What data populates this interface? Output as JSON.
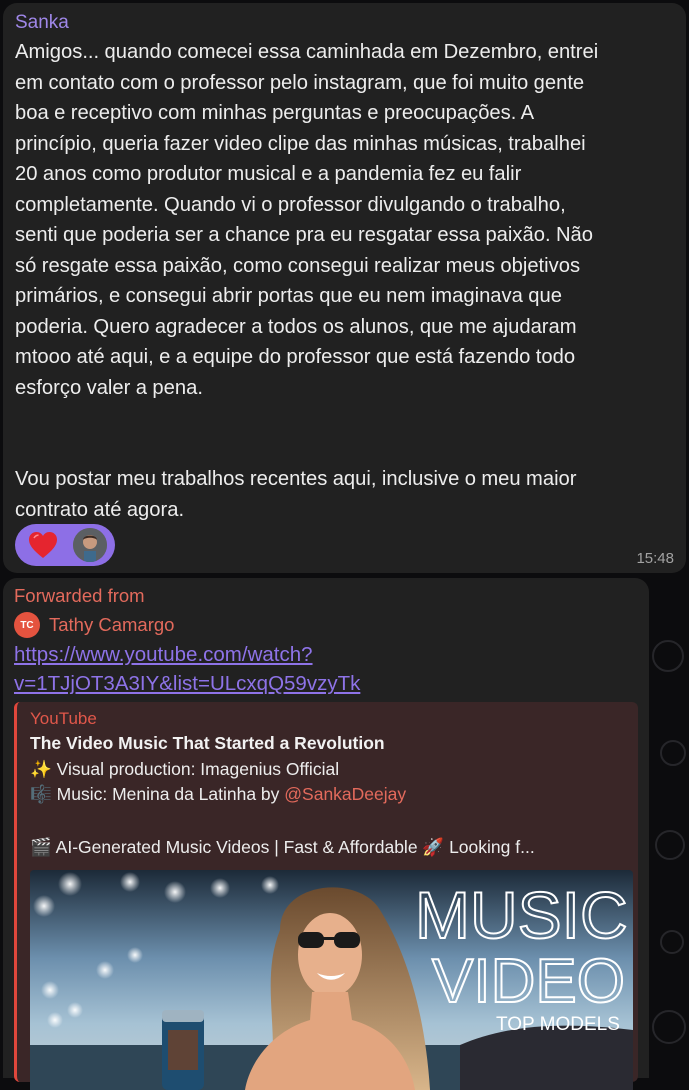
{
  "message1": {
    "sender": "Sanka",
    "lines": [
      "Amigos... quando comecei essa caminhada em Dezembro, entrei",
      "em contato com o professor pelo instagram, que foi muito gente",
      "boa e receptivo com minhas perguntas e preocupações. A",
      "princípio, queria fazer video clipe das minhas músicas, trabalhei",
      "20 anos como produtor musical e a pandemia fez eu falir",
      "completamente. Quando vi o professor divulgando o trabalho,",
      "senti que poderia ser a chance pra eu resgatar essa paixão. Não",
      "só resgate essa paixão, como consegui realizar meus objetivos",
      "primários, e consegui abrir portas que eu nem imaginava que",
      "poderia. Quero agradecer a todos os alunos, que me ajudaram",
      "mtooo até aqui, e a equipe do professor que está fazendo todo",
      "esforço valer a pena.",
      "",
      "",
      "Vou postar meu trabalhos recentes aqui, inclusive o meu maior",
      "contrato até agora."
    ],
    "reaction_icon": "heart-icon",
    "time": "15:48"
  },
  "message2": {
    "forwarded_label": "Forwarded from",
    "forwarded_initials": "TC",
    "forwarded_name": "Tathy Camargo",
    "link_line1": "https://www.youtube.com/watch?",
    "link_line2": "v=1TJjOT3A3IY&list=ULcxqQ59vzyTk",
    "preview": {
      "site": "YouTube",
      "title": "The Video Music That Started a Revolution",
      "line1": "✨ Visual production: Imagenius Official",
      "line2_prefix": "🎼 Music: Menina da Latinha by ",
      "line2_handle": "@SankaDeejay",
      "line3": "🎬 AI-Generated Music Videos | Fast & Affordable 🚀  Looking f...",
      "thumb_text_1": "MUSIC",
      "thumb_text_2": "VIDEO",
      "thumb_text_3": "TOP MODELS"
    }
  },
  "colors": {
    "accent": "#9f87e8",
    "forward": "#e36a5c",
    "bubble": "#212121"
  }
}
